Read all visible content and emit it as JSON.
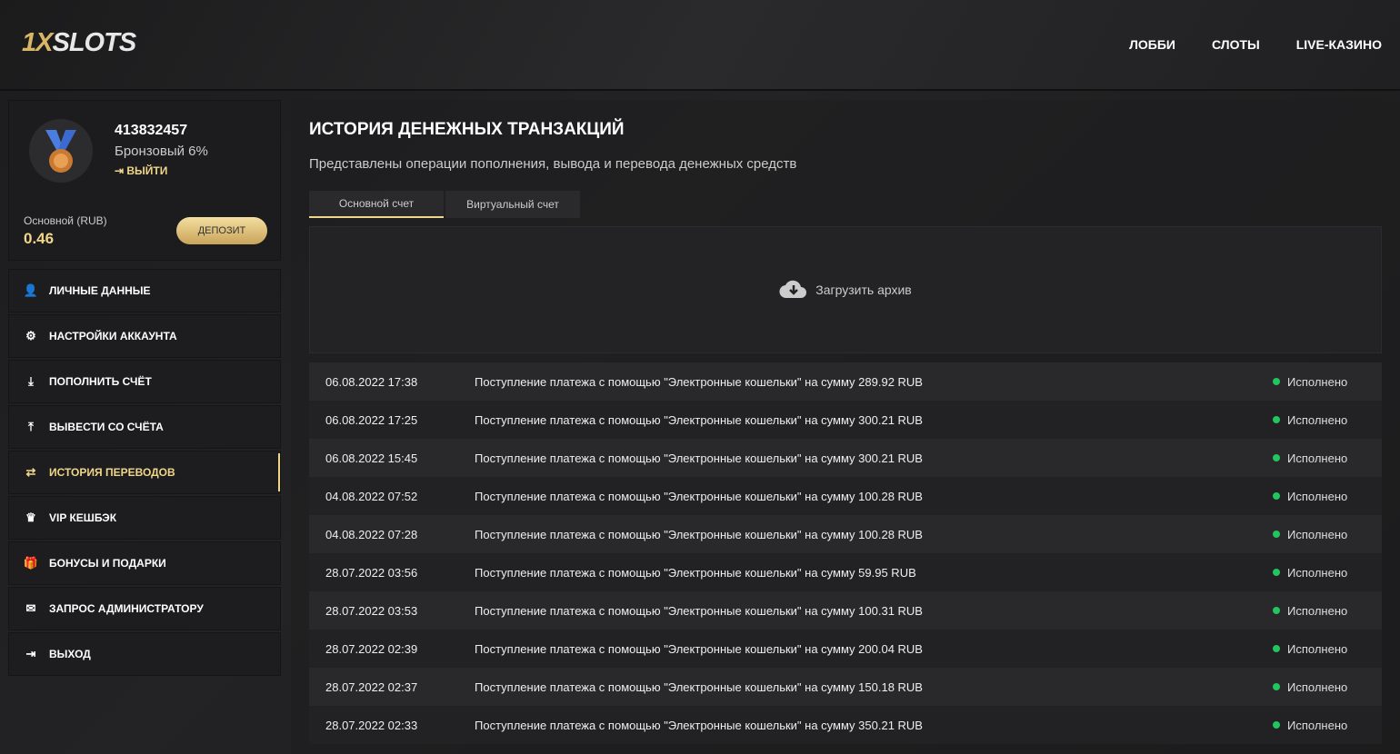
{
  "header": {
    "logo_gold": "1X",
    "logo_silver": "SLOTS",
    "nav": [
      "ЛОББИ",
      "СЛОТЫ",
      "LIVE-КАЗИНО"
    ]
  },
  "profile": {
    "id": "413832457",
    "tier": "Бронзовый 6%",
    "logout": "ВЫЙТИ",
    "account_label": "Основной (RUB)",
    "balance": "0.46",
    "deposit": "ДЕПОЗИТ"
  },
  "menu": [
    {
      "label": "ЛИЧНЫЕ ДАННЫЕ",
      "icon": "user-plus-icon",
      "glyph": "👤"
    },
    {
      "label": "НАСТРОЙКИ АККАУНТА",
      "icon": "gears-icon",
      "glyph": "⚙"
    },
    {
      "label": "ПОПОЛНИТЬ СЧЁТ",
      "icon": "download-icon",
      "glyph": "⤓"
    },
    {
      "label": "ВЫВЕСТИ СО СЧЁТА",
      "icon": "upload-icon",
      "glyph": "⤒"
    },
    {
      "label": "ИСТОРИЯ ПЕРЕВОДОВ",
      "icon": "exchange-icon",
      "glyph": "⇄"
    },
    {
      "label": "VIP КЕШБЭК",
      "icon": "crown-icon",
      "glyph": "♛"
    },
    {
      "label": "БОНУСЫ И ПОДАРКИ",
      "icon": "gift-icon",
      "glyph": "🎁"
    },
    {
      "label": "ЗАПРОС АДМИНИСТРАТОРУ",
      "icon": "envelope-icon",
      "glyph": "✉"
    },
    {
      "label": "ВЫХОД",
      "icon": "sign-out-icon",
      "glyph": "⇥"
    }
  ],
  "main": {
    "title": "ИСТОРИЯ ДЕНЕЖНЫХ ТРАНЗАКЦИЙ",
    "subtitle": "Представлены операции пополнения, вывода и перевода денежных средств",
    "tabs": [
      "Основной счет",
      "Виртуальный счет"
    ],
    "archive": "Загрузить архив"
  },
  "transactions": [
    {
      "date": "06.08.2022 17:38",
      "desc": "Поступление платежа с помощью \"Электронные кошельки\" на сумму 289.92 RUB",
      "status": "Исполнено"
    },
    {
      "date": "06.08.2022 17:25",
      "desc": "Поступление платежа с помощью \"Электронные кошельки\" на сумму 300.21 RUB",
      "status": "Исполнено"
    },
    {
      "date": "06.08.2022 15:45",
      "desc": "Поступление платежа с помощью \"Электронные кошельки\" на сумму 300.21 RUB",
      "status": "Исполнено"
    },
    {
      "date": "04.08.2022 07:52",
      "desc": "Поступление платежа с помощью \"Электронные кошельки\" на сумму 100.28 RUB",
      "status": "Исполнено"
    },
    {
      "date": "04.08.2022 07:28",
      "desc": "Поступление платежа с помощью \"Электронные кошельки\" на сумму 100.28 RUB",
      "status": "Исполнено"
    },
    {
      "date": "28.07.2022 03:56",
      "desc": "Поступление платежа с помощью \"Электронные кошельки\" на сумму 59.95 RUB",
      "status": "Исполнено"
    },
    {
      "date": "28.07.2022 03:53",
      "desc": "Поступление платежа с помощью \"Электронные кошельки\" на сумму 100.31 RUB",
      "status": "Исполнено"
    },
    {
      "date": "28.07.2022 02:39",
      "desc": "Поступление платежа с помощью \"Электронные кошельки\" на сумму 200.04 RUB",
      "status": "Исполнено"
    },
    {
      "date": "28.07.2022 02:37",
      "desc": "Поступление платежа с помощью \"Электронные кошельки\" на сумму 150.18 RUB",
      "status": "Исполнено"
    },
    {
      "date": "28.07.2022 02:33",
      "desc": "Поступление платежа с помощью \"Электронные кошельки\" на сумму 350.21 RUB",
      "status": "Исполнено"
    }
  ]
}
